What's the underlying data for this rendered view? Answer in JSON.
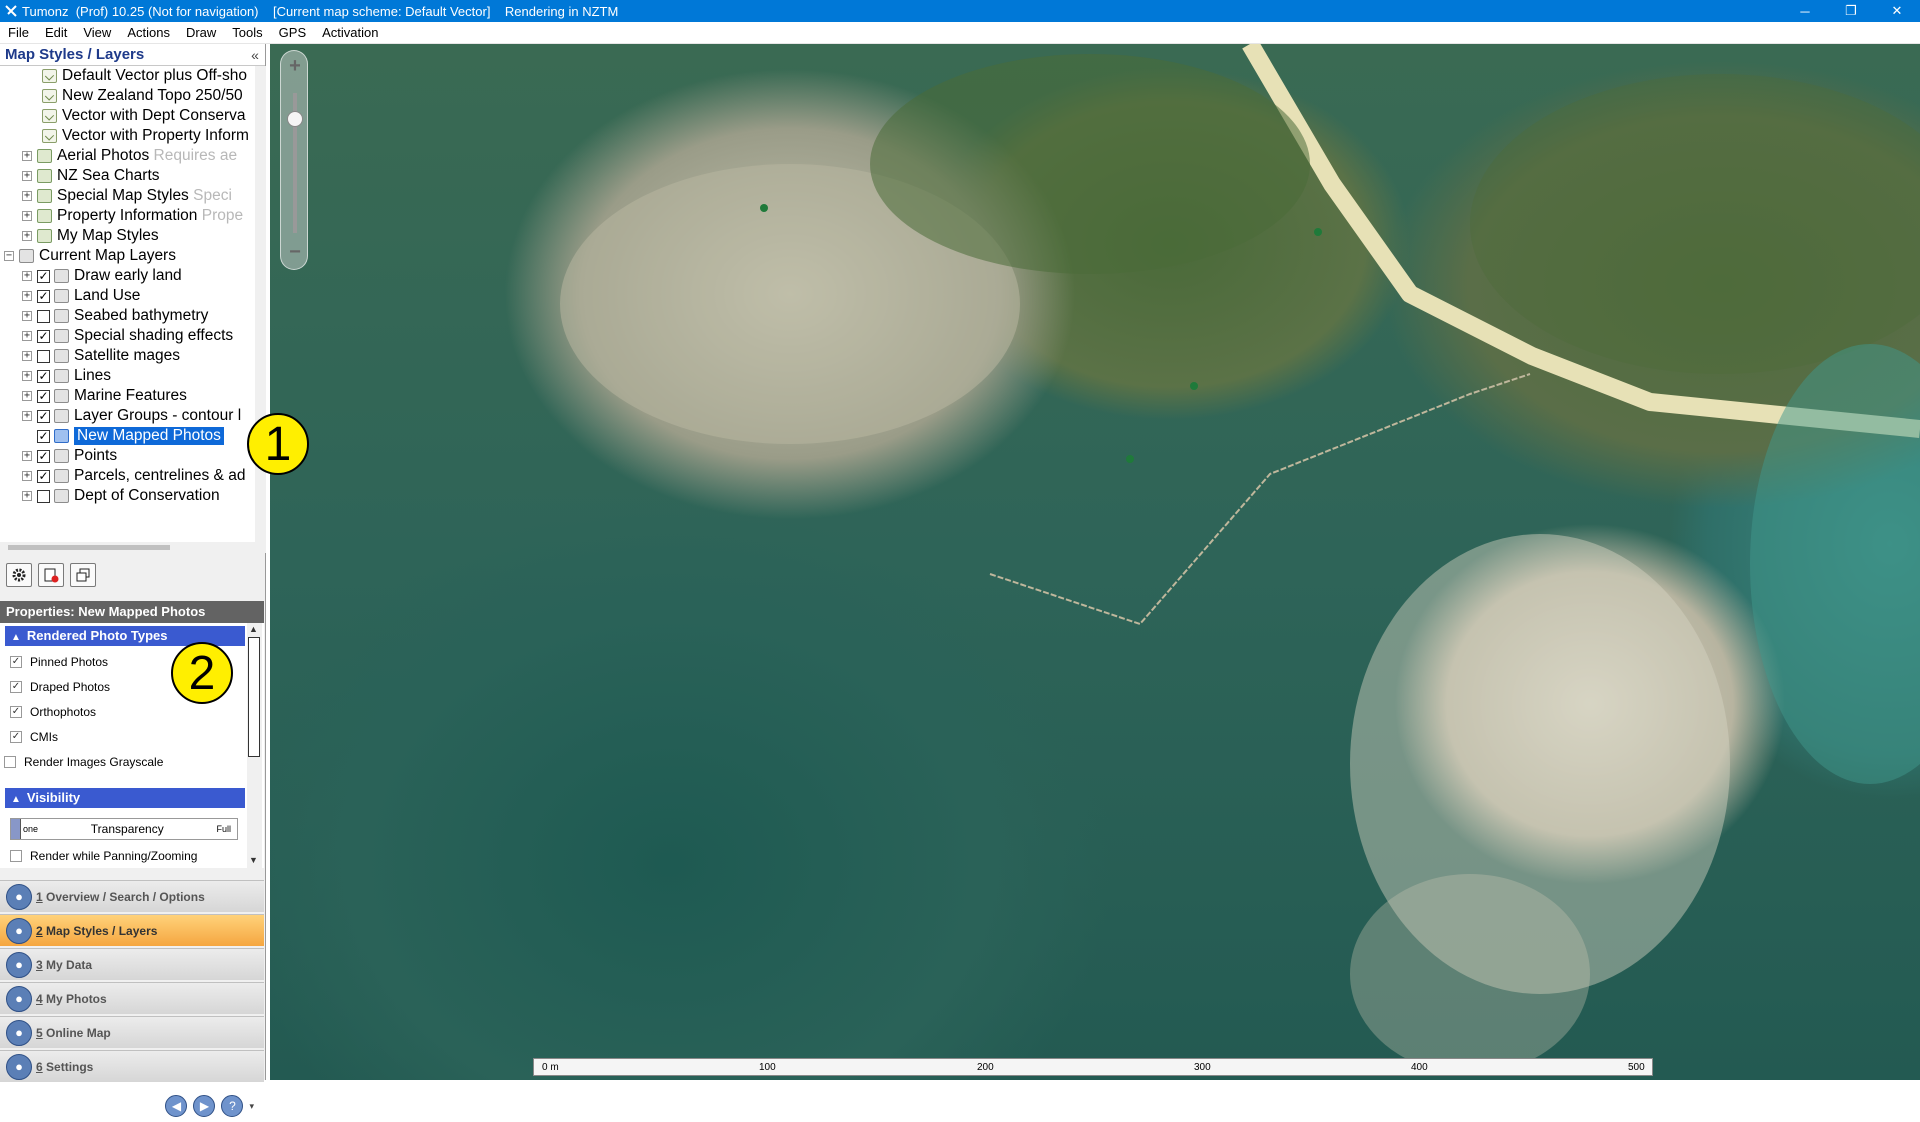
{
  "window": {
    "title": "Tumonz  (Prof) 10.25 (Not for navigation)    [Current map scheme: Default Vector]    Rendering in NZTM",
    "minimize": "─",
    "restore": "❐",
    "close": "✕"
  },
  "menu": [
    "File",
    "Edit",
    "View",
    "Actions",
    "Draw",
    "Tools",
    "GPS",
    "Activation"
  ],
  "panel": {
    "title": "Map Styles / Layers",
    "collapse": "«"
  },
  "tree": {
    "style_items": [
      {
        "label": "Default Vector plus Off-sho"
      },
      {
        "label": "New Zealand Topo 250/50"
      },
      {
        "label": "Vector with Dept Conserva"
      },
      {
        "label": "Vector with Property Inform"
      }
    ],
    "groups": [
      {
        "label": "Aerial Photos",
        "note": "Requires ae"
      },
      {
        "label": "NZ Sea Charts",
        "note": ""
      },
      {
        "label": "Special Map Styles",
        "note": "Speci"
      },
      {
        "label": "Property Information",
        "note": "Prope"
      },
      {
        "label": "My Map Styles",
        "note": ""
      }
    ],
    "current_layers_label": "Current Map Layers",
    "layers": [
      {
        "label": "Draw early land",
        "checked": true
      },
      {
        "label": "Land Use",
        "checked": true
      },
      {
        "label": "Seabed bathymetry",
        "checked": false
      },
      {
        "label": "Special shading effects",
        "checked": true
      },
      {
        "label": "Satellite mages",
        "checked": false
      },
      {
        "label": "Lines",
        "checked": true
      },
      {
        "label": "Marine Features",
        "checked": true
      },
      {
        "label": "Layer Groups - contour l",
        "checked": true
      },
      {
        "label": "New Mapped Photos",
        "checked": true,
        "selected": true
      },
      {
        "label": "Points",
        "checked": true
      },
      {
        "label": "Parcels, centrelines & ad",
        "checked": true
      },
      {
        "label": "Dept of Conservation",
        "checked": false
      }
    ]
  },
  "properties": {
    "title": "Properties: New Mapped Photos",
    "group1_title": "Rendered Photo Types",
    "photo_types": [
      {
        "label": "Pinned Photos",
        "checked": true
      },
      {
        "label": "Draped Photos",
        "checked": true
      },
      {
        "label": "Orthophotos",
        "checked": true
      },
      {
        "label": "CMIs",
        "checked": true
      }
    ],
    "grayscale_label": "Render Images Grayscale",
    "group2_title": "Visibility",
    "transparency": {
      "none": "one",
      "label": "Transparency",
      "full": "Full",
      "value": 0
    },
    "render_panning_label": "Render while Panning/Zooming"
  },
  "nav": [
    {
      "num": "1",
      "label": " Overview / Search / Options",
      "active": false,
      "icon": "search-globe-icon"
    },
    {
      "num": "2",
      "label": " Map Styles / Layers",
      "active": true,
      "icon": "layers-icon"
    },
    {
      "num": "3",
      "label": " My Data",
      "active": false,
      "icon": "my-data-icon"
    },
    {
      "num": "4",
      "label": " My Photos",
      "active": false,
      "icon": "photos-icon"
    },
    {
      "num": "5",
      "label": " Online Map",
      "active": false,
      "icon": "globe-icon"
    },
    {
      "num": "6",
      "label": " Settings",
      "active": false,
      "icon": "settings-icon"
    }
  ],
  "scalebar": {
    "ticks": [
      "0 m",
      "100",
      "200",
      "300",
      "400",
      "500"
    ]
  },
  "callouts": {
    "one": "1",
    "two": "2"
  },
  "zoom": {
    "plus": "+",
    "minus": "−"
  },
  "colors": {
    "title_bar": "#0078d7",
    "selection": "#0e69d8",
    "group_header": "#3a5ad0",
    "nav_active": "#f5a640",
    "callout": "#ffef00"
  }
}
